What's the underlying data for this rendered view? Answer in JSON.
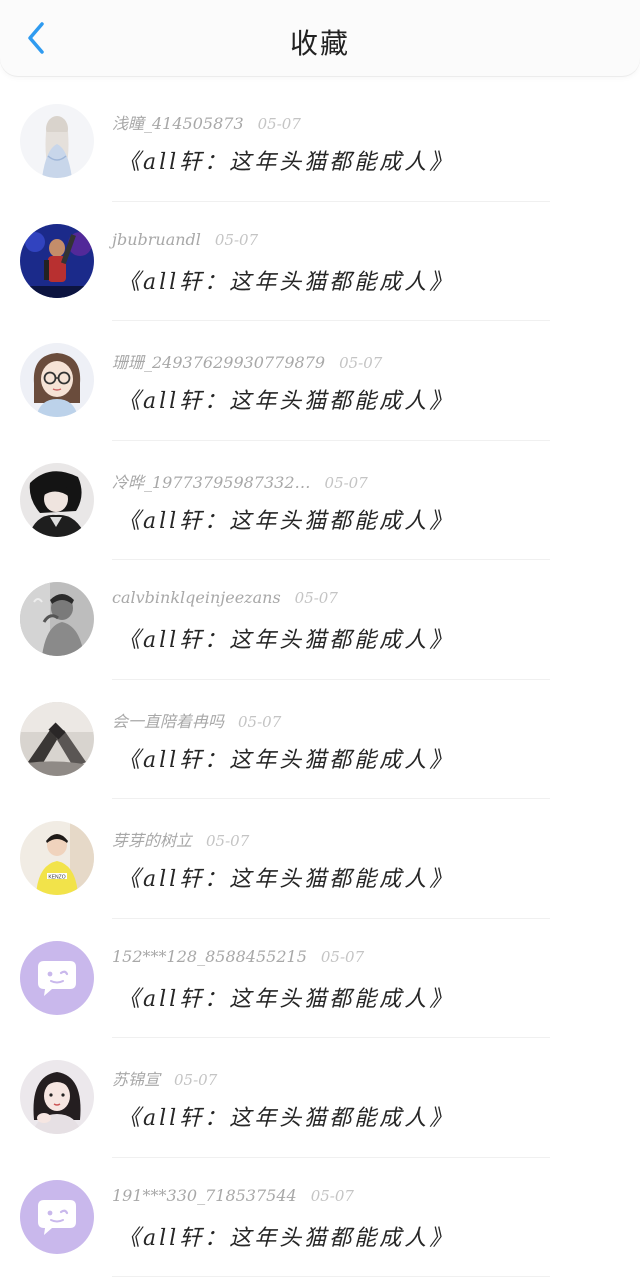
{
  "header": {
    "title": "收藏",
    "back_icon": "chevron-left-icon",
    "accent": "#2f9bf0"
  },
  "items": [
    {
      "user": "浅瞳_414505873",
      "date": "05-07",
      "book": "《all轩：这年头猫都能成人》",
      "avatar": "avatar-girl-white"
    },
    {
      "user": "jbubruandl",
      "date": "05-07",
      "book": "《all轩：这年头猫都能成人》",
      "avatar": "avatar-concert-man"
    },
    {
      "user": "珊珊_24937629930779879",
      "date": "05-07",
      "book": "《all轩：这年头猫都能成人》",
      "avatar": "avatar-glasses-girl"
    },
    {
      "user": "冷晔_19773795987332…",
      "date": "05-07",
      "book": "《all轩：这年头猫都能成人》",
      "avatar": "avatar-dark-anime"
    },
    {
      "user": "calvbinklqeinjeezans",
      "date": "05-07",
      "book": "《all轩：这年头猫都能成人》",
      "avatar": "avatar-grey-man"
    },
    {
      "user": "会一直陪着冉吗",
      "date": "05-07",
      "book": "《all轩：这年头猫都能成人》",
      "avatar": "avatar-hands"
    },
    {
      "user": "芽芽的树立",
      "date": "05-07",
      "book": "《all轩：这年头猫都能成人》",
      "avatar": "avatar-kenzo-boy"
    },
    {
      "user": "152***128_8588455215",
      "date": "05-07",
      "book": "《all轩：这年头猫都能成人》",
      "avatar": "avatar-default-bubble"
    },
    {
      "user": "苏锦宣",
      "date": "05-07",
      "book": "《all轩：这年头猫都能成人》",
      "avatar": "avatar-girl-photo"
    },
    {
      "user": "191***330_718537544",
      "date": "05-07",
      "book": "《all轩：这年头猫都能成人》",
      "avatar": "avatar-default-bubble"
    }
  ],
  "colors": {
    "default_avatar_bg": "#c9b8ec",
    "meta_text": "#a8a8a8",
    "title_text": "#262626"
  }
}
